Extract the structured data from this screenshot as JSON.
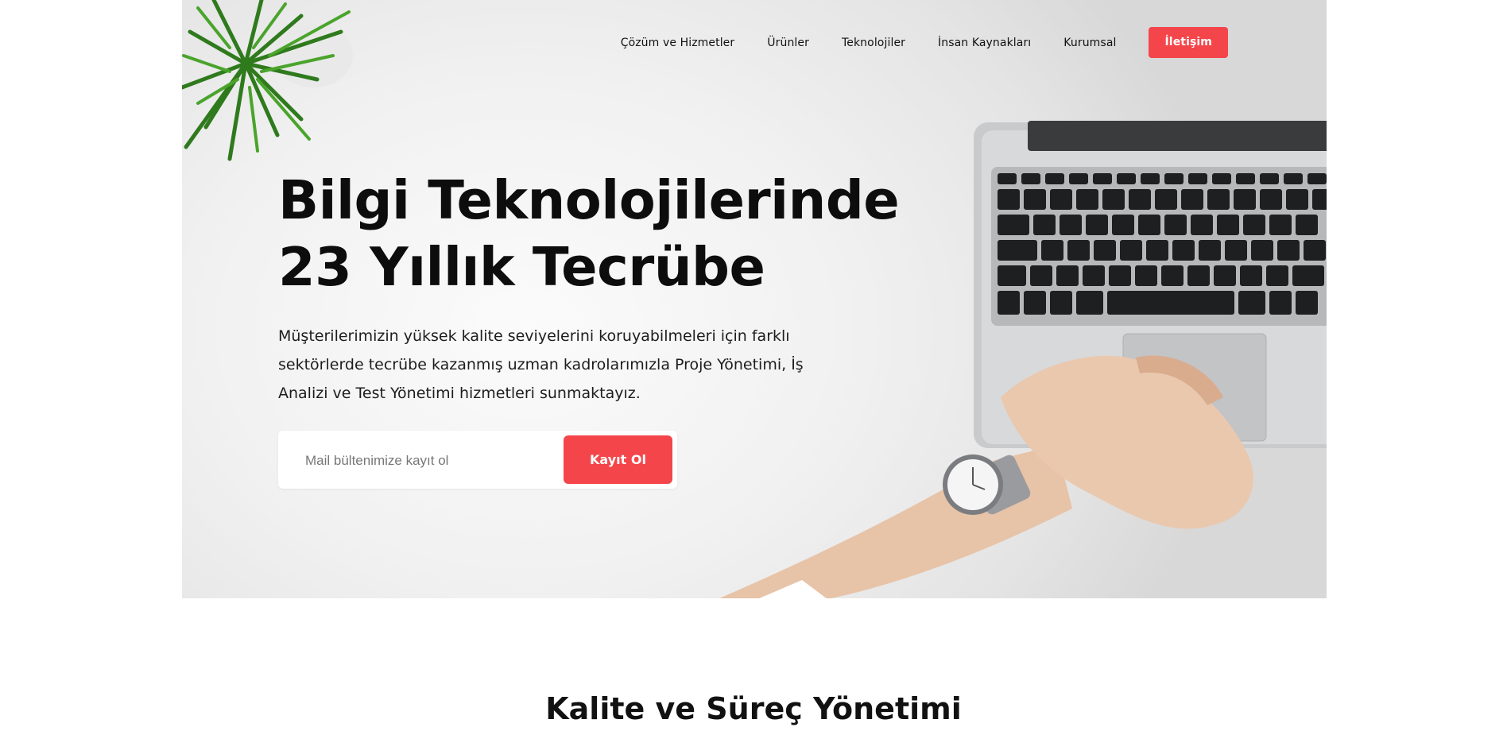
{
  "nav": {
    "items": [
      {
        "label": "Çözüm ve Hizmetler"
      },
      {
        "label": "Ürünler"
      },
      {
        "label": "Teknolojiler"
      },
      {
        "label": "İnsan Kaynakları"
      },
      {
        "label": "Kurumsal"
      }
    ],
    "cta_label": "İletişim"
  },
  "hero": {
    "headline_line1": "Bilgi Teknolojilerinde",
    "headline_line2": "23 Yıllık Tecrübe",
    "lead": "Müşterilerimizin yüksek kalite seviyelerini koruyabilmeleri için farklı sektörlerde tecrübe kazanmış uzman kadrolarımızla Proje Yönetimi, İş Analizi ve Test Yönetimi hizmetleri sunmaktayız."
  },
  "subscribe": {
    "placeholder": "Mail bültenimize kayıt ol",
    "value": "",
    "button_label": "Kayıt Ol"
  },
  "section": {
    "title": "Kalite ve Süreç Yönetimi"
  },
  "colors": {
    "accent": "#f4454a",
    "text": "#111111",
    "background": "#ffffff"
  }
}
